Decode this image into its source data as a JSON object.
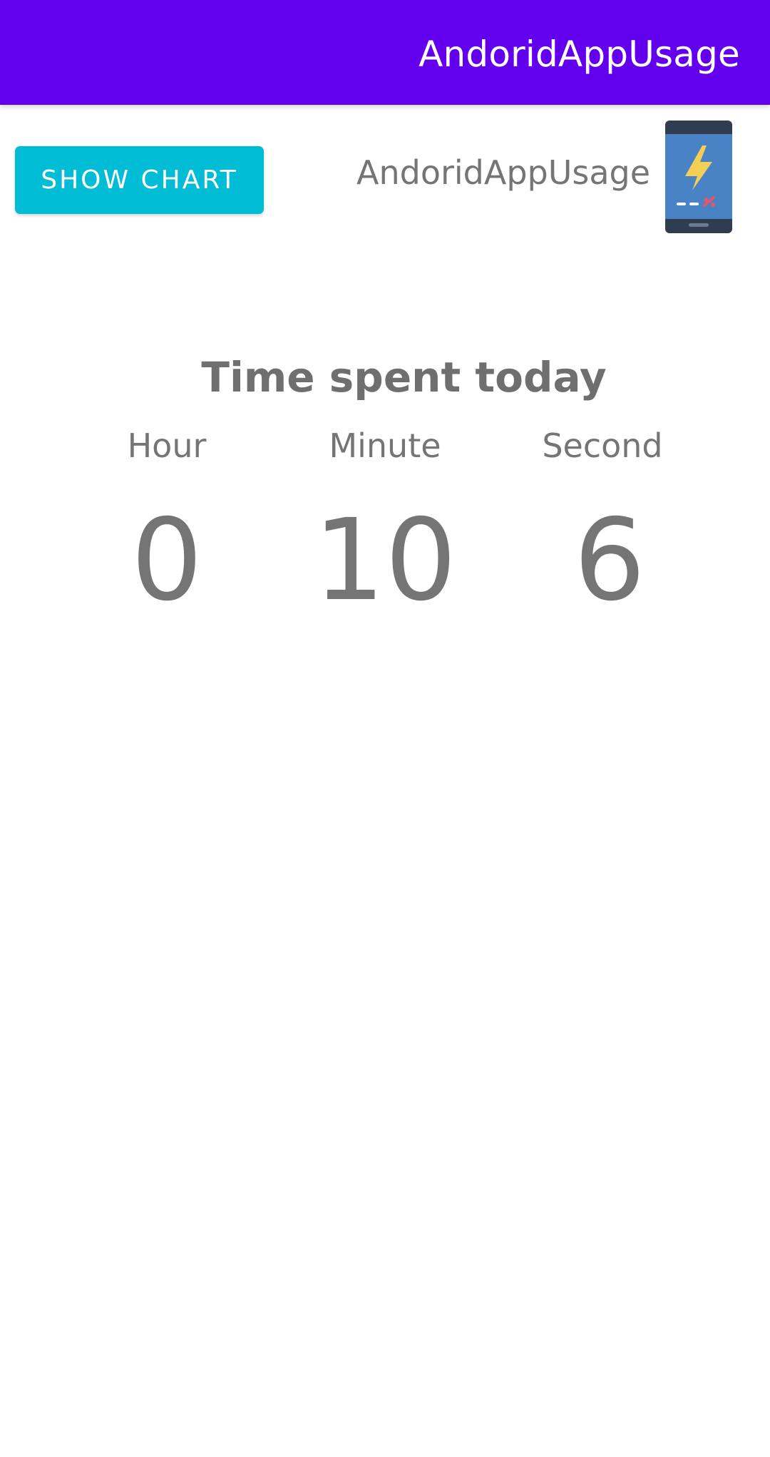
{
  "app_bar": {
    "title": "AndoridAppUsage",
    "color": "#6200ee"
  },
  "header": {
    "show_chart_label": "SHOW CHART",
    "show_chart_color": "#00bcd4",
    "app_name": "AndoridAppUsage",
    "app_icon": "phone-battery-icon"
  },
  "usage": {
    "title": "Time spent today",
    "hour_label": "Hour",
    "minute_label": "Minute",
    "second_label": "Second",
    "hour_value": "0",
    "minute_value": "10",
    "second_value": "6"
  }
}
